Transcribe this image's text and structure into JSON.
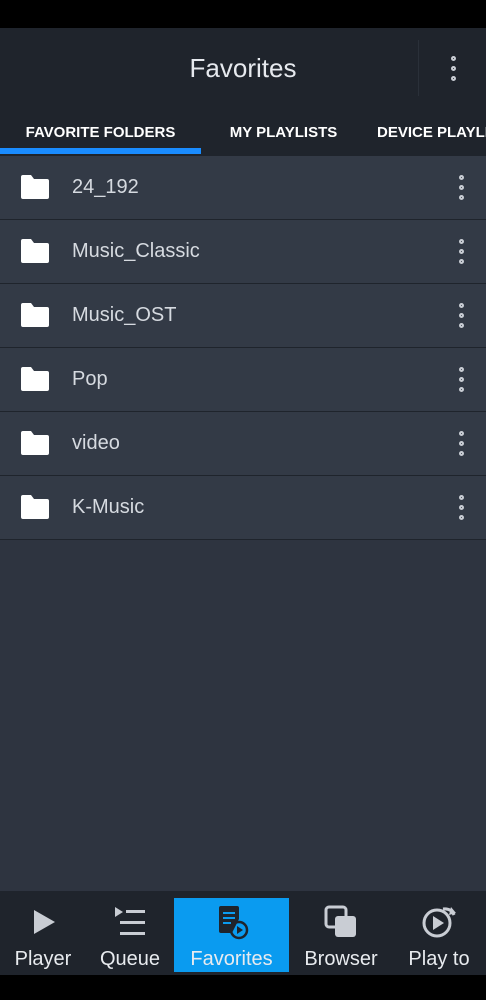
{
  "header": {
    "title": "Favorites",
    "menu_icon": "more-vertical-icon"
  },
  "tabs": [
    {
      "label": "FAVORITE FOLDERS",
      "active": true
    },
    {
      "label": "MY PLAYLISTS",
      "active": false
    },
    {
      "label": "DEVICE PLAYLI",
      "active": false
    }
  ],
  "folders": [
    {
      "name": "24_192"
    },
    {
      "name": "Music_Classic"
    },
    {
      "name": "Music_OST"
    },
    {
      "name": "Pop"
    },
    {
      "name": "video"
    },
    {
      "name": "K-Music"
    }
  ],
  "bottom_nav": [
    {
      "label": "Player",
      "icon": "play-icon",
      "active": false
    },
    {
      "label": "Queue",
      "icon": "queue-icon",
      "active": false
    },
    {
      "label": "Favorites",
      "icon": "favorites-icon",
      "active": true
    },
    {
      "label": "Browser",
      "icon": "browser-icon",
      "active": false
    },
    {
      "label": "Play to",
      "icon": "play-to-icon",
      "active": false
    }
  ],
  "colors": {
    "accent": "#1a8cff",
    "active_nav": "#0a9bf0",
    "background": "#2e3440",
    "bar": "#1f242c"
  }
}
